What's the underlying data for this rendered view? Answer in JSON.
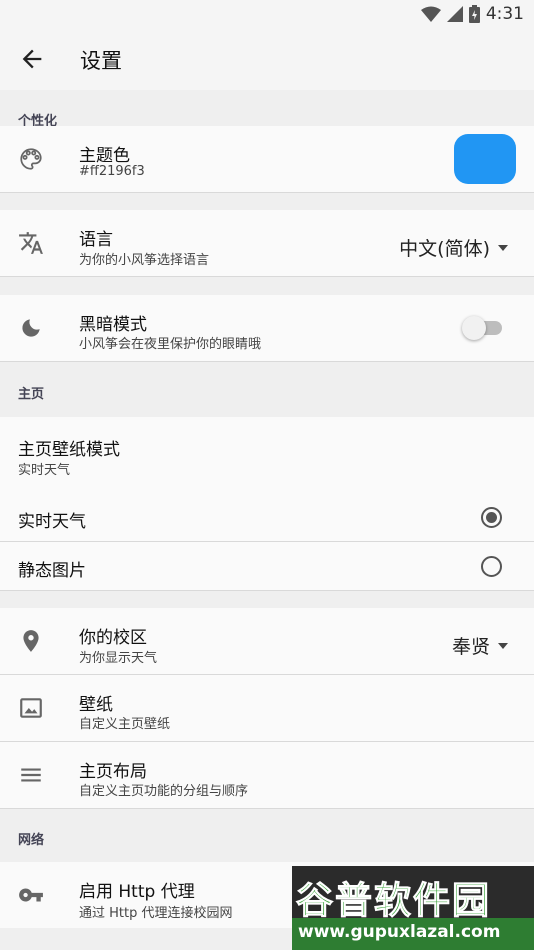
{
  "status_bar": {
    "time": "4:31"
  },
  "app_bar": {
    "title": "设置"
  },
  "sections": {
    "personalize": "个性化",
    "home": "主页",
    "network": "网络"
  },
  "theme_color": {
    "title": "主题色",
    "value": "#ff2196f3",
    "swatch_color": "#2196f3"
  },
  "language": {
    "title": "语言",
    "subtitle": "为你的小风筝选择语言",
    "selected": "中文(简体)"
  },
  "dark_mode": {
    "title": "黑暗模式",
    "subtitle": "小风筝会在夜里保护你的眼睛哦",
    "enabled": false
  },
  "wallpaper_mode": {
    "title": "主页壁纸模式",
    "subtitle": "实时天气",
    "options": [
      {
        "label": "实时天气",
        "selected": true
      },
      {
        "label": "静态图片",
        "selected": false
      }
    ]
  },
  "campus": {
    "title": "你的校区",
    "subtitle": "为你显示天气",
    "selected": "奉贤"
  },
  "wallpaper": {
    "title": "壁纸",
    "subtitle": "自定义主页壁纸"
  },
  "home_layout": {
    "title": "主页布局",
    "subtitle": "自定义主页功能的分组与顺序"
  },
  "http_proxy": {
    "title": "启用 Http 代理",
    "subtitle": "通过 Http 代理连接校园网"
  },
  "watermark": {
    "cn": "谷普软件园",
    "url": "www.gupuxlazal.com"
  }
}
